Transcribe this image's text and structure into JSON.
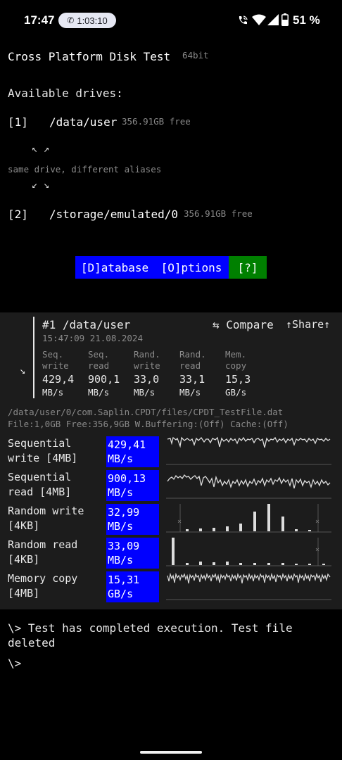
{
  "status_bar": {
    "time": "17:47",
    "call_timer": "1:03:10",
    "battery": "51 %"
  },
  "app": {
    "title": "Cross Platform Disk Test",
    "arch": "64bit",
    "drives_heading": "Available drives:",
    "drives": [
      {
        "index": "[1]",
        "path": "/data/user",
        "free": "356.91GB free"
      },
      {
        "index": "[2]",
        "path": "/storage/emulated/0",
        "free": "356.91GB free"
      }
    ],
    "alias_arrows_top": "↖ ↗",
    "alias_note": "same drive, different aliases",
    "alias_arrows_bottom": "↙ ↘",
    "buttons": {
      "database": "[D]atabase",
      "options": "[O]ptions",
      "help": "[?]"
    },
    "colors": {
      "button_blue": "#0000ff",
      "button_green": "#008000",
      "value_blue": "#0000ff"
    }
  },
  "result": {
    "title": "#1 /data/user",
    "timestamp": "15:47:09 21.08.2024",
    "compare": "⇆ Compare",
    "share": "↑Share↑",
    "expand_arrow": "↘",
    "metrics": [
      {
        "h1": "Seq.",
        "h2": "write",
        "value": "429,4",
        "unit": "MB/s"
      },
      {
        "h1": "Seq.",
        "h2": "read",
        "value": "900,1",
        "unit": "MB/s"
      },
      {
        "h1": "Rand.",
        "h2": "write",
        "value": "33,0",
        "unit": "MB/s"
      },
      {
        "h1": "Rand.",
        "h2": "read",
        "value": "33,1",
        "unit": "MB/s"
      },
      {
        "h1": "Mem.",
        "h2": "copy",
        "value": "15,3",
        "unit": "GB/s"
      }
    ],
    "file_path": "/data/user/0/com.Saplin.CPDT/files/CPDT_TestFile.dat",
    "file_info": "File:1,0GB Free:356,9GB W.Buffering:(Off) Cache:(Off)",
    "rows": [
      {
        "l1": "Sequential",
        "l2": "write [4MB]",
        "v1": "429,41",
        "v2": "MB/s"
      },
      {
        "l1": "Sequential",
        "l2": "read [4MB]",
        "v1": "900,13",
        "v2": "MB/s"
      },
      {
        "l1": "Random write",
        "l2": "[4KB]",
        "v1": "32,99",
        "v2": "MB/s"
      },
      {
        "l1": "Random read",
        "l2": "[4KB]",
        "v1": "33,09",
        "v2": "MB/s"
      },
      {
        "l1": "Memory copy",
        "l2": "[4MB]",
        "v1": "15,31",
        "v2": "GB/s"
      }
    ]
  },
  "console": {
    "message_line1": "\\> Test has completed execution. Test file",
    "message_line2": "deleted",
    "prompt": "\\>"
  }
}
